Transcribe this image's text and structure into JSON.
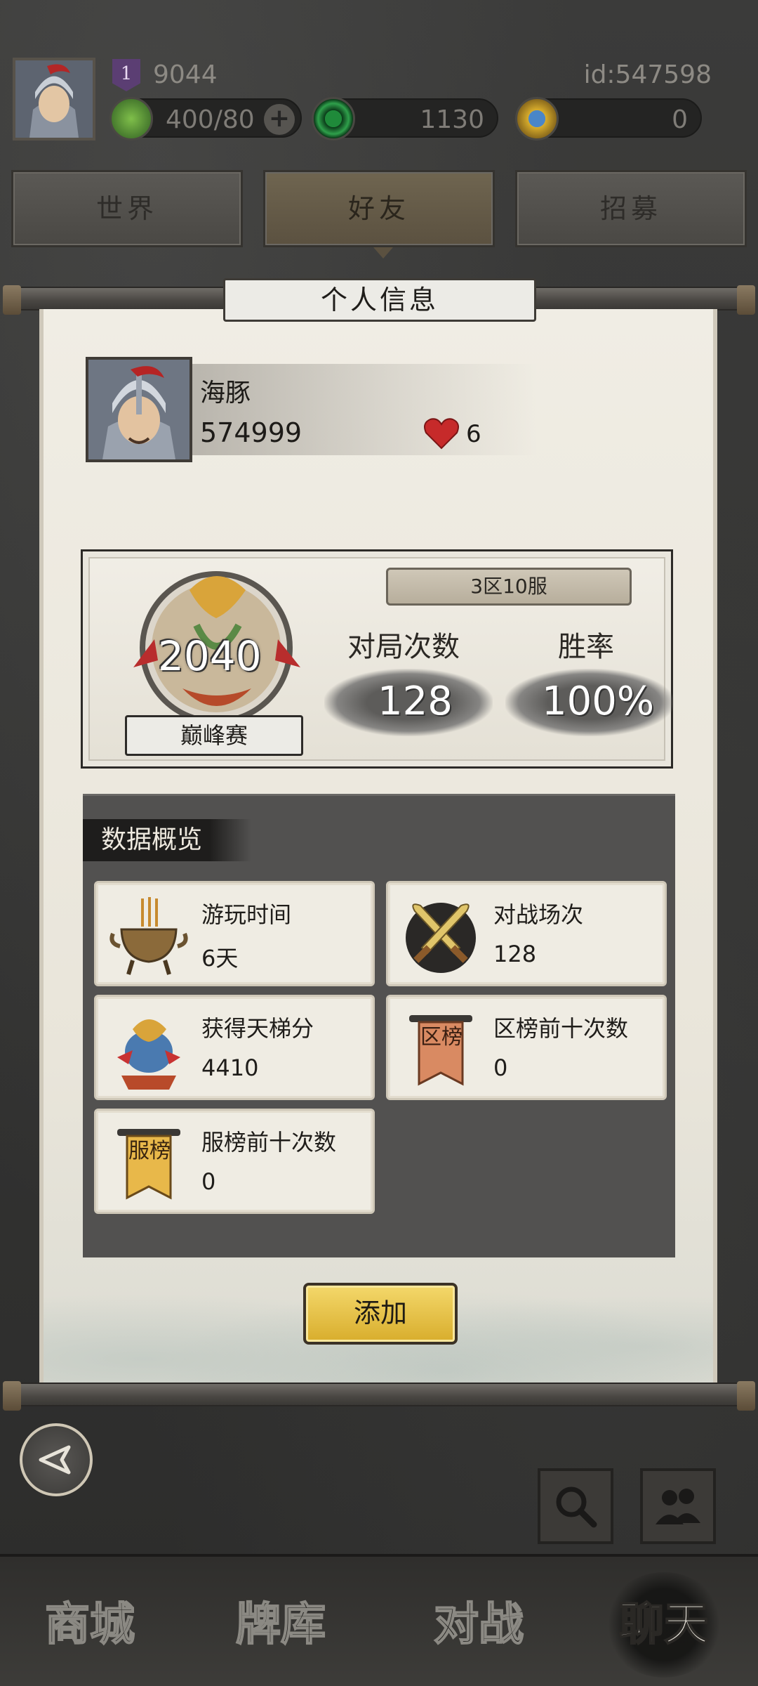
{
  "header": {
    "level": "1",
    "power": "9044",
    "user_id": "id:547598",
    "stamina": "400/80",
    "jade": "1130",
    "gold": "0",
    "plus_label": "+"
  },
  "tabs": [
    {
      "label": "世界"
    },
    {
      "label": "好友"
    },
    {
      "label": "招募"
    }
  ],
  "panel": {
    "title": "个人信息",
    "nickname": "海豚",
    "score": "574999",
    "likes": "6"
  },
  "rank": {
    "value": "2040",
    "mode": "巅峰赛",
    "server": "3区10服",
    "matches_label": "对局次数",
    "matches_value": "128",
    "winrate_label": "胜率",
    "winrate_value": "100%"
  },
  "overview": {
    "title": "数据概览",
    "cards": [
      {
        "name": "游玩时间",
        "value": "6天",
        "icon": "incense-burner-icon"
      },
      {
        "name": "对战场次",
        "value": "128",
        "icon": "crossed-swords-icon"
      },
      {
        "name": "获得天梯分",
        "value": "4410",
        "icon": "dragon-trophy-icon"
      },
      {
        "name": "区榜前十次数",
        "value": "0",
        "icon": "region-banner-icon",
        "banner": "区榜"
      },
      {
        "name": "服榜前十次数",
        "value": "0",
        "icon": "server-banner-icon",
        "banner": "服榜"
      }
    ]
  },
  "actions": {
    "add_label": "添加"
  },
  "nav": [
    {
      "label": "商城"
    },
    {
      "label": "牌库"
    },
    {
      "label": "对战"
    },
    {
      "label": "聊天"
    }
  ],
  "colors": {
    "accent_gold": "#d8ad2c",
    "heart_red": "#c62a2a",
    "background": "#2f2f2e",
    "paper": "#efece3"
  }
}
